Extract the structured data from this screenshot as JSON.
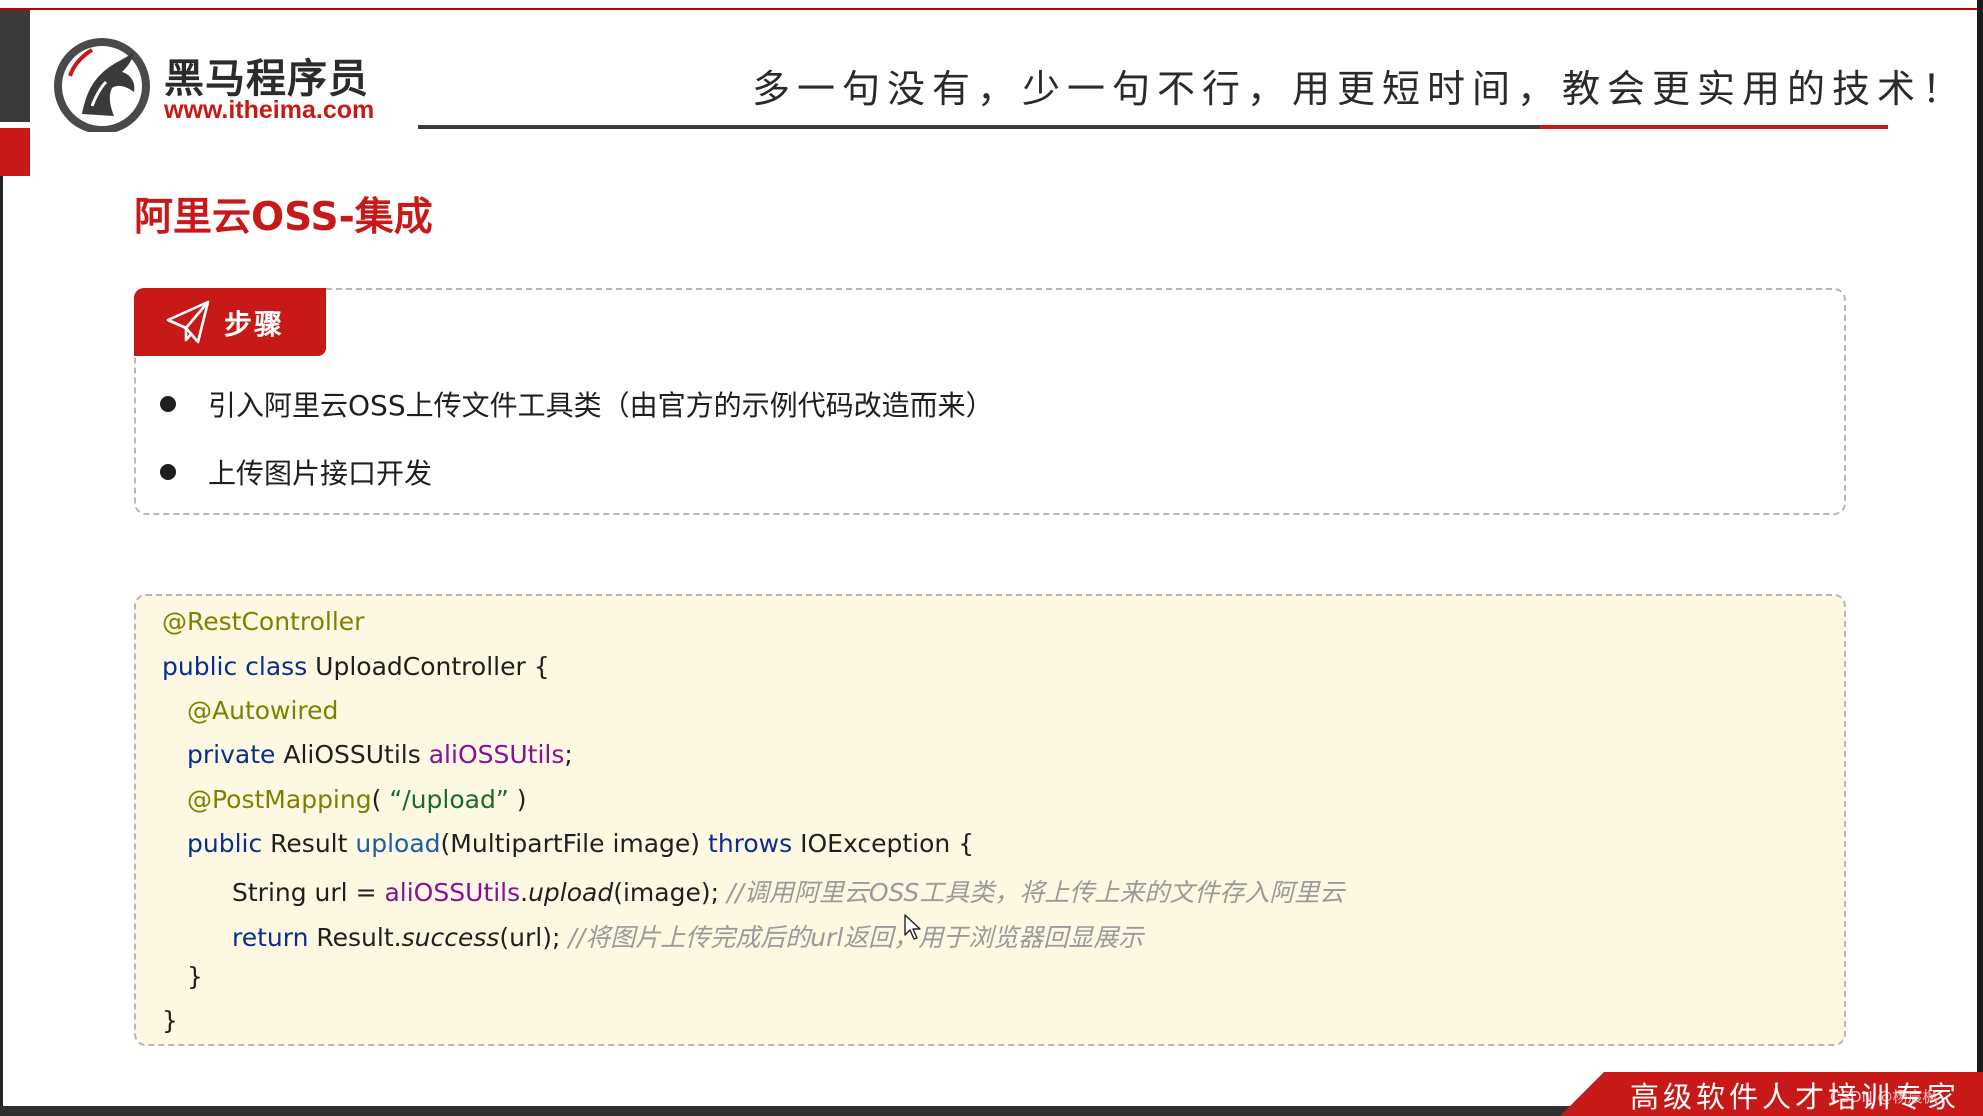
{
  "colors": {
    "brand_red": "#c81919",
    "code_bg": "#fdf8e2",
    "annotation": "#808000",
    "keyword": "#0b2e8e",
    "field": "#871094",
    "comment": "#9a9a9a"
  },
  "header": {
    "logo_icon": "horse-logo-icon",
    "logo_name": "黑马程序员",
    "logo_url": "www.itheima.com",
    "slogan": "多一句没有，少一句不行，用更短时间，教会更实用的技术！"
  },
  "section": {
    "title": "阿里云OSS-集成"
  },
  "steps": {
    "tag_icon": "paper-plane-icon",
    "tag_label": "步骤",
    "items": [
      "引入阿里云OSS上传文件工具类（由官方的示例代码改造而来）",
      "上传图片接口开发"
    ]
  },
  "code": {
    "anno_rest": "@RestController",
    "kw_public_class": "public class",
    "class_decl": " UploadController {",
    "anno_autowired": "@Autowired",
    "kw_private": "private",
    "field_type": " AliOSSUtils ",
    "field_name": "aliOSSUtils",
    "semicolon": ";",
    "anno_post": "@PostMapping",
    "post_open": "( ",
    "post_path": "“/upload”",
    "post_close": " )",
    "kw_public": "public",
    "ret_type": " Result ",
    "method_name": "upload",
    "method_params": "(MultipartFile image) ",
    "kw_throws": "throws",
    "exception": " IOException {",
    "line7_prefix": "String url = ",
    "line7_obj": "aliOSSUtils",
    "line7_dot": ".",
    "line7_call": "upload",
    "line7_args": "(image); ",
    "line7_comment": "//调用阿里云OSS工具类，将上传上来的文件存入阿里云",
    "kw_return": "return",
    "line8_obj": " Result.",
    "line8_call": "success",
    "line8_args": "(url); ",
    "line8_comment": "//将图片上传完成后的url返回，用于浏览器回显展示",
    "brace_inner": "}",
    "brace_outer": "}"
  },
  "footer": {
    "banner_text": "高级软件人才培训专家",
    "watermark": "CSDN @杨宸枫"
  }
}
